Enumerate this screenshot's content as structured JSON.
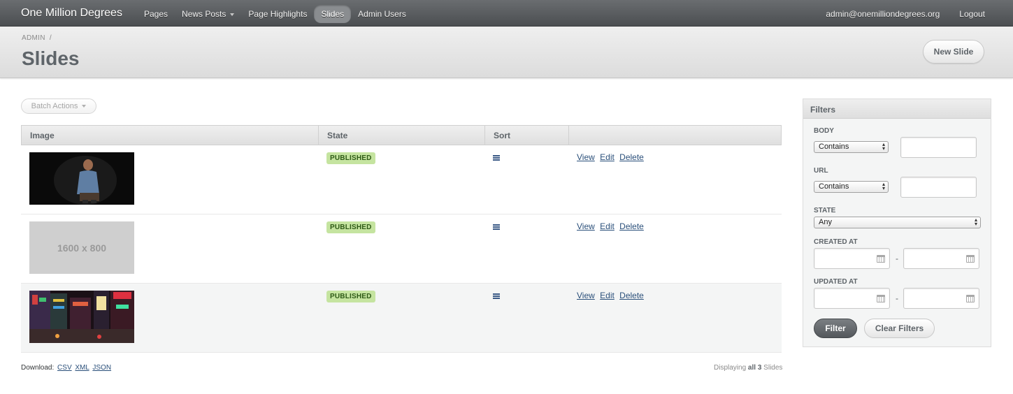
{
  "header": {
    "site_title": "One Million Degrees",
    "nav": [
      {
        "label": "Pages"
      },
      {
        "label": "News Posts",
        "has_dropdown": true
      },
      {
        "label": "Page Highlights"
      },
      {
        "label": "Slides",
        "active": true
      },
      {
        "label": "Admin Users"
      }
    ],
    "user_email": "admin@onemilliondegrees.org",
    "logout_label": "Logout"
  },
  "titlebar": {
    "breadcrumb": "ADMIN",
    "breadcrumb_sep": "/",
    "page_title": "Slides",
    "new_button": "New Slide"
  },
  "batch_actions_label": "Batch Actions",
  "table": {
    "columns": [
      "Image",
      "State",
      "Sort",
      ""
    ],
    "rows": [
      {
        "image": "photo-man-portrait",
        "state": "PUBLISHED",
        "actions": [
          "View",
          "Edit",
          "Delete"
        ]
      },
      {
        "image": "placeholder",
        "placeholder_text": "1600 x 800",
        "state": "PUBLISHED",
        "actions": [
          "View",
          "Edit",
          "Delete"
        ]
      },
      {
        "image": "photo-city-night",
        "state": "PUBLISHED",
        "actions": [
          "View",
          "Edit",
          "Delete"
        ]
      }
    ]
  },
  "footer": {
    "download_label": "Download:",
    "formats": [
      "CSV",
      "XML",
      "JSON"
    ],
    "displaying_prefix": "Displaying",
    "displaying_count": "all 3",
    "displaying_suffix": "Slides"
  },
  "filters": {
    "title": "Filters",
    "body_label": "BODY",
    "body_select": "Contains",
    "url_label": "URL",
    "url_select": "Contains",
    "state_label": "STATE",
    "state_select": "Any",
    "created_label": "CREATED AT",
    "updated_label": "UPDATED AT",
    "range_sep": "-",
    "filter_button": "Filter",
    "clear_button": "Clear Filters"
  },
  "colors": {
    "header_bg": "#5a5d60",
    "badge_bg": "#c5e4a0",
    "badge_text": "#2e5a16",
    "link": "#2a4f7a"
  }
}
